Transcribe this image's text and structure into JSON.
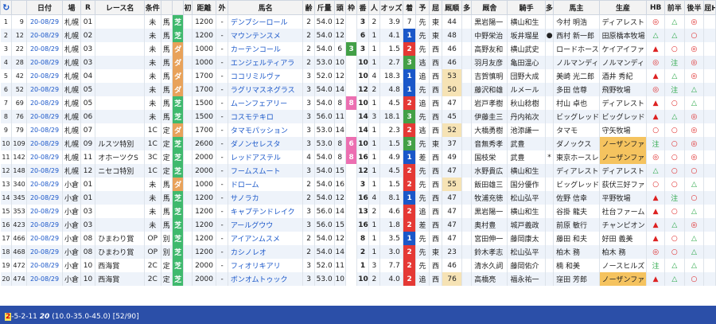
{
  "headers": [
    "C",
    "日付",
    "場",
    "R",
    "レース名",
    "条件",
    "",
    "",
    "初",
    "距離",
    "外",
    "馬名",
    "齢",
    "斤量",
    "頭",
    "枠",
    "番",
    "人",
    "オッズ",
    "着",
    "予",
    "屈",
    "厩順",
    "多",
    "厩舎",
    "騎手",
    "多",
    "馬主",
    "生産",
    "HB",
    "前半",
    "後半",
    "屈H"
  ],
  "rows": [
    [
      "1",
      "9",
      "20-08/29",
      "札幌",
      "01",
      "",
      "未",
      "馬",
      "芝",
      "",
      "1200",
      "-",
      "デンプシーロール",
      "2",
      "54.0",
      "12",
      "3",
      "3",
      "2",
      "3.9",
      "7",
      "先",
      "東",
      "44",
      "",
      "黒岩陽一",
      "横山和生",
      "",
      "今村 明浩",
      "ディアレスト",
      "◎",
      "△",
      "◎"
    ],
    [
      "2",
      "12",
      "20-08/29",
      "札幌",
      "02",
      "",
      "未",
      "馬",
      "芝",
      "",
      "1200",
      "-",
      "マウンテンスメ",
      "2",
      "54.0",
      "12",
      "5",
      "6",
      "1",
      "4.1",
      "1",
      "先",
      "東",
      "48",
      "",
      "中野栄治",
      "坂井瑠星",
      "●",
      "西村 新一郎",
      "田原橋本牧場",
      "△",
      "△",
      "○"
    ],
    [
      "3",
      "22",
      "20-08/29",
      "札幌",
      "03",
      "",
      "未",
      "馬",
      "ダ",
      "",
      "1000",
      "-",
      "カーテンコール",
      "2",
      "54.0",
      "6",
      "3",
      "3",
      "1",
      "1.5",
      "2",
      "先",
      "西",
      "46",
      "",
      "高野友和",
      "横山武史",
      "",
      "ロードホース",
      "ケイアイファ",
      "▲",
      "○",
      "◎"
    ],
    [
      "4",
      "28",
      "20-08/29",
      "札幌",
      "03",
      "",
      "未",
      "馬",
      "ダ",
      "",
      "1000",
      "-",
      "エンジェルティアラ",
      "2",
      "53.0",
      "10",
      "7",
      "10",
      "1",
      "2.7",
      "3",
      "逃",
      "西",
      "46",
      "",
      "羽月友彦",
      "亀田温心",
      "",
      "ノルマンディ",
      "ノルマンディ",
      "◎",
      "注",
      "◎"
    ],
    [
      "5",
      "42",
      "20-08/29",
      "札幌",
      "04",
      "",
      "未",
      "馬",
      "ダ",
      "",
      "1700",
      "-",
      "ココリミルヴァ",
      "3",
      "52.0",
      "12",
      "7",
      "10",
      "4",
      "18.3",
      "1",
      "追",
      "西",
      "53",
      "",
      "吉賀慎明",
      "団野大成",
      "",
      "美崎 光二郎",
      "酒井 秀紀",
      "▲",
      "△",
      "◎"
    ],
    [
      "6",
      "52",
      "20-08/29",
      "札幌",
      "05",
      "",
      "未",
      "馬",
      "ダ",
      "",
      "1700",
      "-",
      "ラグリマスネグラス",
      "3",
      "54.0",
      "14",
      "7",
      "12",
      "2",
      "4.8",
      "1",
      "先",
      "西",
      "50",
      "",
      "藤沢和雄",
      "ルメール",
      "",
      "多田 信尊",
      "飛野牧場",
      "◎",
      "注",
      "△"
    ],
    [
      "7",
      "69",
      "20-08/29",
      "札幌",
      "05",
      "",
      "未",
      "馬",
      "芝",
      "",
      "1500",
      "-",
      "ムーンフェアリー",
      "3",
      "54.0",
      "8",
      "8",
      "10",
      "1",
      "4.5",
      "2",
      "追",
      "西",
      "47",
      "",
      "岩戸孝樹",
      "秋山稔樹",
      "",
      "村山 卓也",
      "ディアレスト",
      "▲",
      "○",
      "△"
    ],
    [
      "8",
      "76",
      "20-08/29",
      "札幌",
      "06",
      "",
      "未",
      "馬",
      "芝",
      "",
      "1500",
      "-",
      "コスモテキロ",
      "3",
      "56.0",
      "11",
      "8",
      "14",
      "3",
      "18.1",
      "3",
      "先",
      "西",
      "45",
      "",
      "伊藤圭三",
      "丹内祐次",
      "",
      "ビッグレッド",
      "ビッグレッド",
      "▲",
      "△",
      "◎"
    ],
    [
      "9",
      "79",
      "20-08/29",
      "札幌",
      "07",
      "",
      "1C",
      "定",
      "ダ",
      "",
      "1700",
      "-",
      "タマモパッション",
      "3",
      "53.0",
      "14",
      "8",
      "14",
      "1",
      "2.3",
      "2",
      "逃",
      "西",
      "52",
      "",
      "大橋勇樹",
      "池添謙一",
      "",
      "タマモ",
      "守矢牧場",
      "○",
      "○",
      "◎"
    ],
    [
      "10",
      "109",
      "20-08/29",
      "札幌",
      "09",
      "ルスツ特別",
      "1C",
      "定",
      "芝",
      "",
      "2600",
      "-",
      "ダノンセレスタ",
      "3",
      "53.0",
      "8",
      "6",
      "10",
      "1",
      "1.5",
      "3",
      "先",
      "東",
      "37",
      "",
      "音無秀孝",
      "武豊",
      "",
      "ダノックス",
      "ノーザンファ",
      "注",
      "○",
      "◎"
    ],
    [
      "11",
      "142",
      "20-08/29",
      "札幌",
      "11",
      "オホーツクS",
      "3C",
      "定",
      "芝",
      "",
      "2000",
      "-",
      "レッドアステル",
      "4",
      "54.0",
      "8",
      "8",
      "16",
      "1",
      "4.9",
      "1",
      "差",
      "西",
      "49",
      "",
      "国枝栄",
      "武豊",
      "*",
      "東京ホースレ",
      "ノーザンファ",
      "◎",
      "○",
      "◎"
    ],
    [
      "12",
      "148",
      "20-08/29",
      "札幌",
      "12",
      "ニセコ特別",
      "1C",
      "定",
      "芝",
      "",
      "2000",
      "-",
      "フームスムート",
      "3",
      "54.0",
      "15",
      "8",
      "12",
      "1",
      "4.5",
      "2",
      "先",
      "西",
      "47",
      "",
      "水野貴広",
      "横山和生",
      "",
      "ディアレスト",
      "ディアレスト",
      "△",
      "○",
      "○"
    ],
    [
      "13",
      "340",
      "20-08/29",
      "小倉",
      "01",
      "",
      "未",
      "馬",
      "ダ",
      "",
      "1000",
      "-",
      "ドローム",
      "2",
      "54.0",
      "16",
      "3",
      "3",
      "1",
      "1.5",
      "2",
      "先",
      "西",
      "55",
      "",
      "飯田雄三",
      "国分優作",
      "",
      "ビッグレッド",
      "荻伏三好ファ",
      "○",
      "○",
      "△"
    ],
    [
      "14",
      "345",
      "20-08/29",
      "小倉",
      "01",
      "",
      "未",
      "馬",
      "芝",
      "",
      "1200",
      "-",
      "サノラカ",
      "2",
      "54.0",
      "12",
      "8",
      "16",
      "4",
      "8.1",
      "1",
      "先",
      "西",
      "47",
      "",
      "牧浦充徳",
      "松山弘平",
      "",
      "佐野 信幸",
      "平野牧場",
      "▲",
      "注",
      "○"
    ],
    [
      "15",
      "353",
      "20-08/29",
      "小倉",
      "03",
      "",
      "未",
      "馬",
      "芝",
      "",
      "1200",
      "-",
      "キャプテンドレイク",
      "3",
      "56.0",
      "14",
      "7",
      "13",
      "2",
      "4.6",
      "2",
      "追",
      "西",
      "47",
      "",
      "黒岩陽一",
      "横山和生",
      "",
      "谷掛 龍夫",
      "社台ファーム",
      "▲",
      "○",
      "△"
    ],
    [
      "16",
      "423",
      "20-08/29",
      "小倉",
      "03",
      "",
      "未",
      "馬",
      "芝",
      "",
      "1200",
      "-",
      "アールグウウ",
      "3",
      "56.0",
      "15",
      "8",
      "16",
      "1",
      "1.8",
      "2",
      "差",
      "西",
      "47",
      "",
      "奥村豊",
      "城戸義政",
      "",
      "前原 敏行",
      "チャンピオン",
      "▲",
      "△",
      "◎"
    ],
    [
      "17",
      "466",
      "20-08/29",
      "小倉",
      "08",
      "ひまわり賞",
      "OP",
      "別",
      "芝",
      "",
      "1200",
      "-",
      "アイアンムスメ",
      "2",
      "54.0",
      "12",
      "8",
      "8",
      "1",
      "3.5",
      "1",
      "先",
      "西",
      "47",
      "",
      "宮田伸一",
      "藤岡康太",
      "",
      "藤田 和夫",
      "好田 義美",
      "▲",
      "○",
      "△"
    ],
    [
      "18",
      "468",
      "20-08/29",
      "小倉",
      "08",
      "ひまわり賞",
      "OP",
      "別",
      "芝",
      "",
      "1200",
      "-",
      "カシノレオ",
      "2",
      "54.0",
      "14",
      "5",
      "2",
      "1",
      "3.0",
      "2",
      "先",
      "東",
      "23",
      "",
      "鈴木孝志",
      "松山弘平",
      "",
      "柏木 務",
      "柏木 務",
      "◎",
      "○",
      "△"
    ],
    [
      "19",
      "472",
      "20-08/29",
      "小倉",
      "10",
      "西海賞",
      "2C",
      "定",
      "芝",
      "",
      "2000",
      "-",
      "フィオリキアリ",
      "3",
      "52.0",
      "11",
      "1",
      "1",
      "3",
      "7.7",
      "2",
      "先",
      "西",
      "46",
      "",
      "清水久詞",
      "藤岡佑介",
      "",
      "楠 和美",
      "ノースヒルズ",
      "注",
      "△",
      "△"
    ],
    [
      "20",
      "474",
      "20-08/29",
      "小倉",
      "10",
      "西海賞",
      "2C",
      "定",
      "芝",
      "",
      "2000",
      "-",
      "ボンオムトゥック",
      "3",
      "53.0",
      "10",
      "2",
      "10",
      "2",
      "4.0",
      "2",
      "追",
      "西",
      "76",
      "",
      "高橋亮",
      "福永祐一",
      "",
      "窪田 芳郎",
      "ノーザンファ",
      "▲",
      "△",
      "○"
    ]
  ],
  "status": {
    "mark": "2",
    "text": "-5-2-11",
    "bold": "20",
    "rest": "(10.0-35.0-45.0) [52/90]"
  },
  "colors": {
    "waku1": "#ffffff",
    "waku2": "#333333",
    "waku3": "#e53935",
    "waku4": "#1e88e5",
    "waku5": "#fbc02d",
    "waku6": "#43a047",
    "waku7": "#fb8c00",
    "waku8": "#ec6fb1"
  }
}
